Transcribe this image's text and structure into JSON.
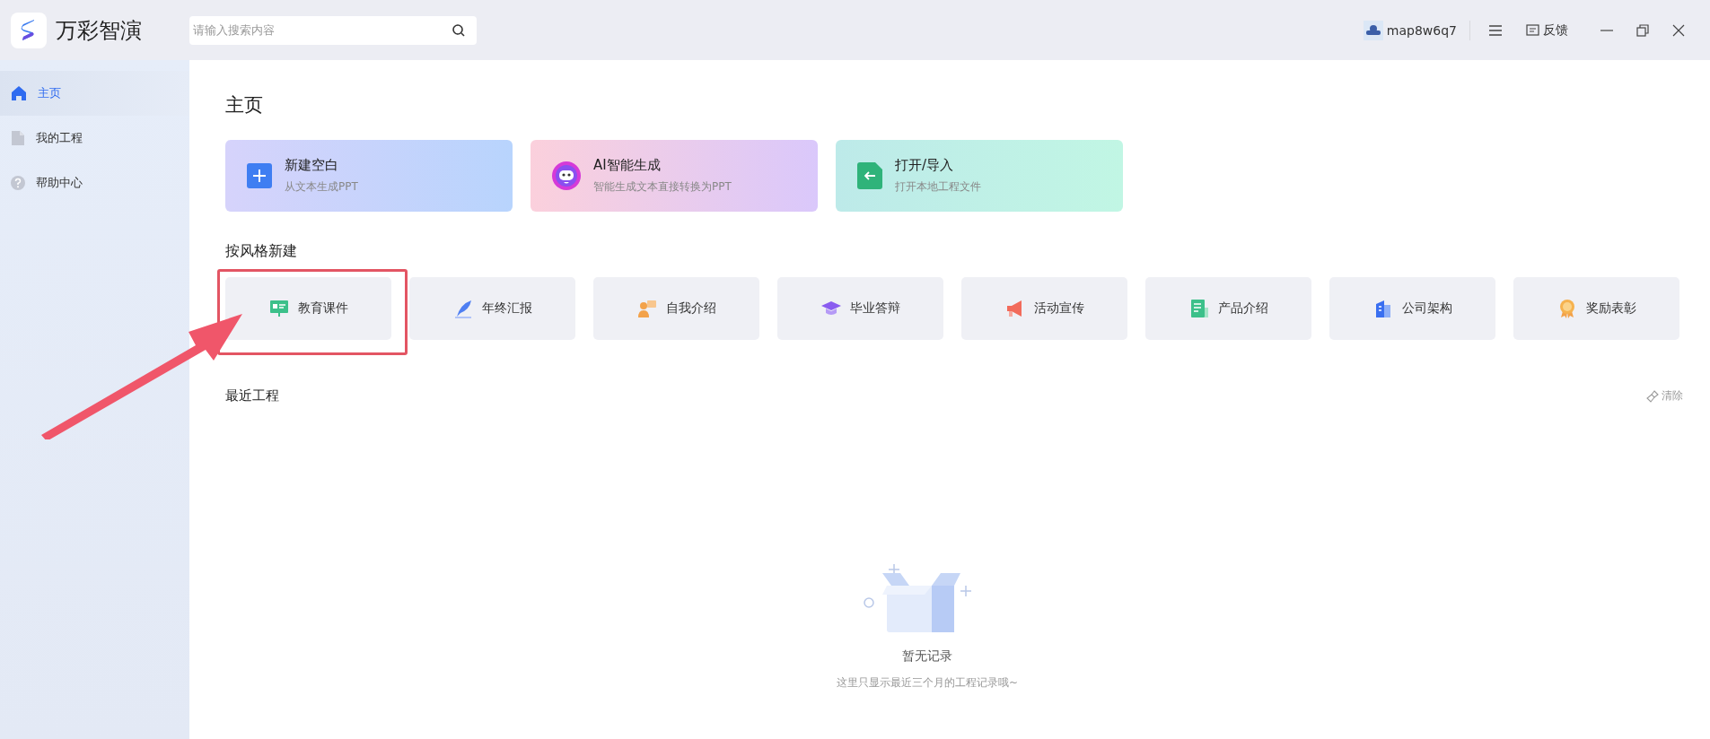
{
  "app": {
    "name": "万彩智演"
  },
  "search": {
    "placeholder": "请输入搜索内容"
  },
  "user": {
    "name": "map8w6q7"
  },
  "feedback": {
    "label": "反馈"
  },
  "sidebar": {
    "items": [
      {
        "label": "主页",
        "kind": "home",
        "selected": true
      },
      {
        "label": "我的工程",
        "kind": "file",
        "selected": false
      },
      {
        "label": "帮助中心",
        "kind": "help",
        "selected": false
      }
    ]
  },
  "page_title": "主页",
  "actions": [
    {
      "kind": "new",
      "title": "新建空白",
      "subtitle": "从文本生成PPT"
    },
    {
      "kind": "ai",
      "title": "AI智能生成",
      "subtitle": "智能生成文本直接转换为PPT"
    },
    {
      "kind": "open",
      "title": "打开/导入",
      "subtitle": "打开本地工程文件"
    }
  ],
  "styles_heading": "按风格新建",
  "styles": [
    {
      "kind": "education",
      "label": "教育课件",
      "highlighted": true
    },
    {
      "kind": "report",
      "label": "年终汇报",
      "highlighted": false
    },
    {
      "kind": "intro",
      "label": "自我介绍",
      "highlighted": false
    },
    {
      "kind": "graduation",
      "label": "毕业答辩",
      "highlighted": false
    },
    {
      "kind": "promo",
      "label": "活动宣传",
      "highlighted": false
    },
    {
      "kind": "product",
      "label": "产品介绍",
      "highlighted": false
    },
    {
      "kind": "company",
      "label": "公司架构",
      "highlighted": false
    },
    {
      "kind": "award",
      "label": "奖励表彰",
      "highlighted": false
    }
  ],
  "recent": {
    "heading": "最近工程",
    "clear": "清除",
    "empty_title": "暂无记录",
    "empty_hint": "这里只显示最近三个月的工程记录哦~"
  }
}
